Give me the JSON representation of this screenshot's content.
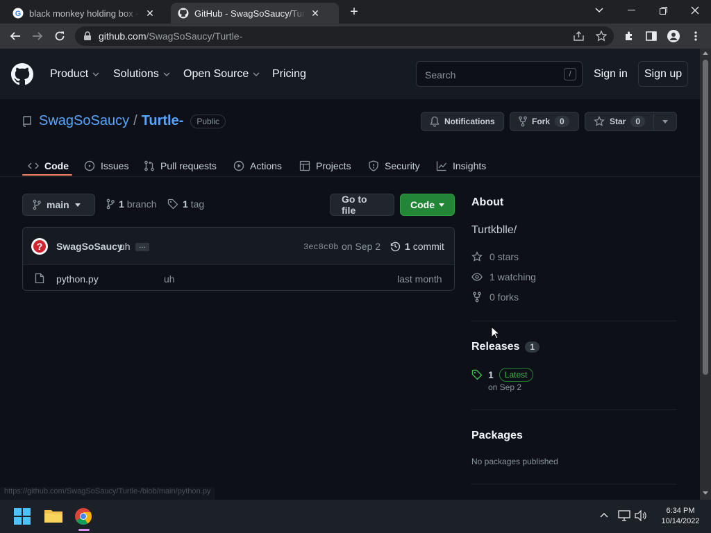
{
  "browser": {
    "tabs": [
      {
        "title": "black monkey holding box - Goo",
        "icon": "google-icon",
        "active": false
      },
      {
        "title": "GitHub - SwagSoSaucy/Turtle-: T",
        "icon": "github-icon",
        "active": true
      }
    ],
    "url_host": "github.com",
    "url_path": "/SwagSoSaucy/Turtle-"
  },
  "github_header": {
    "nav": [
      "Product",
      "Solutions",
      "Open Source",
      "Pricing"
    ],
    "search_placeholder": "Search",
    "search_key": "/",
    "sign_in": "Sign in",
    "sign_up": "Sign up"
  },
  "repo": {
    "owner": "SwagSoSaucy",
    "separator": "/",
    "name": "Turtle-",
    "visibility": "Public",
    "notifications_label": "Notifications",
    "fork_label": "Fork",
    "fork_count": "0",
    "star_label": "Star",
    "star_count": "0",
    "tabs": [
      "Code",
      "Issues",
      "Pull requests",
      "Actions",
      "Projects",
      "Security",
      "Insights"
    ]
  },
  "files": {
    "branch": "main",
    "branch_count": "1",
    "branch_word": "branch",
    "tag_count": "1",
    "tag_word": "tag",
    "go_to_file": "Go to file",
    "code_button": "Code",
    "commit_author": "SwagSoSaucy",
    "commit_message": "uh",
    "commit_more": "…",
    "commit_sha": "3ec8c0b",
    "commit_date": "on Sep 2",
    "commit_count": "1",
    "commit_word": "commit",
    "rows": [
      {
        "name": "python.py",
        "message": "uh",
        "date": "last month"
      }
    ]
  },
  "about": {
    "heading": "About",
    "description": "Turtkblle/",
    "stars": "0 stars",
    "watching": "1 watching",
    "forks": "0 forks",
    "releases_heading": "Releases",
    "releases_count": "1",
    "release_name": "1",
    "release_badge": "Latest",
    "release_date": "on Sep 2",
    "packages_heading": "Packages",
    "packages_text": "No packages published"
  },
  "status_url": "https://github.com/SwagSoSaucy/Turtle-/blob/main/python.py",
  "taskbar": {
    "time": "6:34 PM",
    "date": "10/14/2022"
  },
  "colors": {
    "accent_link": "#58a6ff",
    "primary_button": "#238636",
    "latest_badge": "#3fb950",
    "tab_underline": "#f78166"
  }
}
